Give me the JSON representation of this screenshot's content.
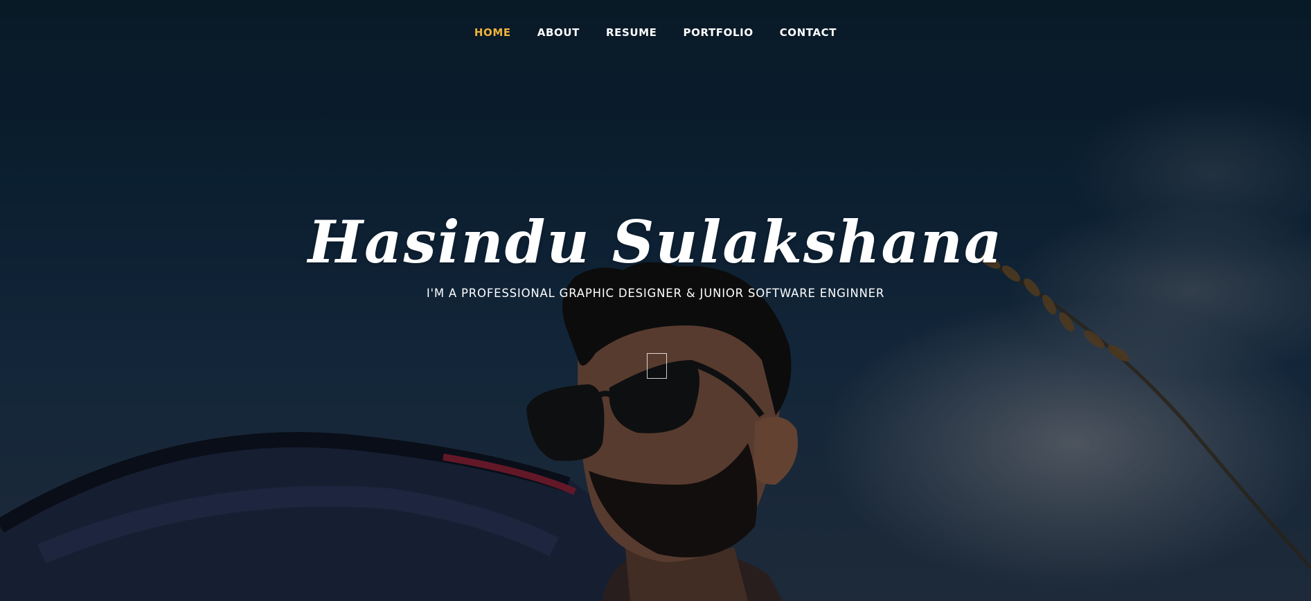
{
  "nav": {
    "items": [
      {
        "label": "HOME",
        "active": true
      },
      {
        "label": "ABOUT",
        "active": false
      },
      {
        "label": "RESUME",
        "active": false
      },
      {
        "label": "PORTFOLIO",
        "active": false
      },
      {
        "label": "CONTACT",
        "active": false
      }
    ],
    "active_color": "#f0b33c"
  },
  "banner": {
    "name": "Hasindu Sulakshana",
    "subtitle": "I'M A PROFESSIONAL GRAPHIC DESIGNER & JUNIOR SOFTWARE ENGINNER"
  },
  "scroll_icon": "scroll-down-icon",
  "background": {
    "photo": "man-with-sunglasses-portrait",
    "sky_color": "#0f2b43",
    "cloud_color": "#7b838c"
  }
}
